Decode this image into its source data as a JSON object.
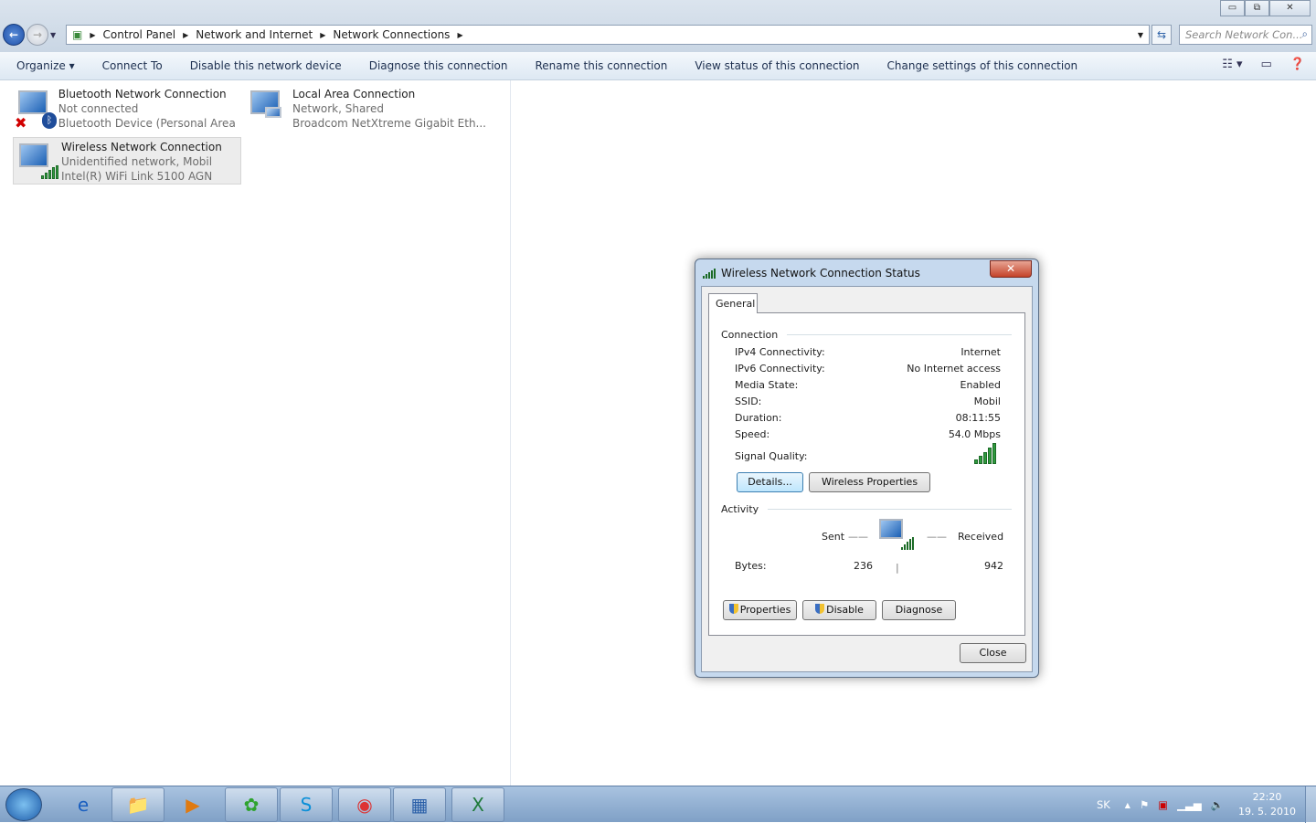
{
  "window": {
    "minimize": "▭",
    "maximize": "⧉",
    "close": "✕"
  },
  "address": {
    "crumbs": [
      "Control Panel",
      "Network and Internet",
      "Network Connections"
    ],
    "search_placeholder": "Search Network Con..."
  },
  "toolbar": {
    "items": [
      "Organize ▾",
      "Connect To",
      "Disable this network device",
      "Diagnose this connection",
      "Rename this connection",
      "View status of this connection",
      "Change settings of this connection"
    ]
  },
  "connections": [
    {
      "name": "Bluetooth Network Connection",
      "status": "Not connected",
      "device": "Bluetooth Device (Personal Area ..."
    },
    {
      "name": "Local Area Connection",
      "status": "Network, Shared",
      "device": "Broadcom NetXtreme Gigabit Eth..."
    },
    {
      "name": "Wireless Network Connection",
      "status": "Unidentified network, Mobil",
      "device": "Intel(R) WiFi Link 5100 AGN"
    }
  ],
  "dialog": {
    "title": "Wireless Network Connection Status",
    "tab": "General",
    "connection_label": "Connection",
    "rows": [
      {
        "label": "IPv4 Connectivity:",
        "value": "Internet"
      },
      {
        "label": "IPv6 Connectivity:",
        "value": "No Internet access"
      },
      {
        "label": "Media State:",
        "value": "Enabled"
      },
      {
        "label": "SSID:",
        "value": "Mobil"
      },
      {
        "label": "Duration:",
        "value": "08:11:55"
      },
      {
        "label": "Speed:",
        "value": "54.0 Mbps"
      }
    ],
    "signal_label": "Signal Quality:",
    "signal_bars": 5,
    "details_btn": "Details...",
    "wireless_props_btn": "Wireless Properties",
    "activity_label": "Activity",
    "sent_label": "Sent",
    "received_label": "Received",
    "bytes_label": "Bytes:",
    "bytes_sent": "236",
    "bytes_received": "942",
    "properties_btn": "Properties",
    "disable_btn": "Disable",
    "diagnose_btn": "Diagnose",
    "close_btn": "Close"
  },
  "taskbar": {
    "lang": "SK",
    "time": "22:20",
    "date": "19. 5. 2010"
  }
}
